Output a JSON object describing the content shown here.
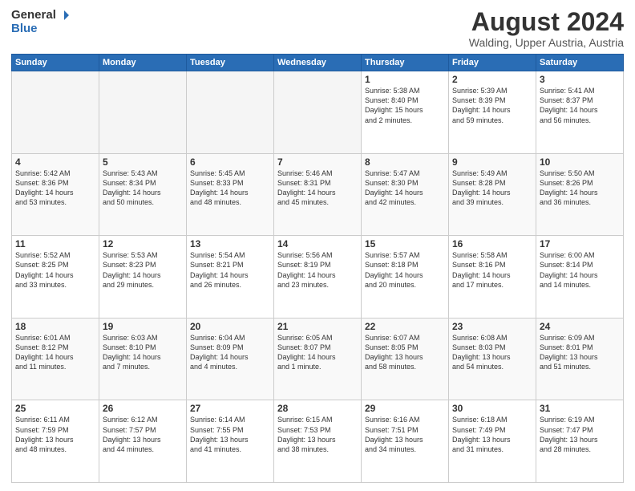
{
  "logo": {
    "general": "General",
    "blue": "Blue"
  },
  "title": "August 2024",
  "subtitle": "Walding, Upper Austria, Austria",
  "days_header": [
    "Sunday",
    "Monday",
    "Tuesday",
    "Wednesday",
    "Thursday",
    "Friday",
    "Saturday"
  ],
  "weeks": [
    [
      {
        "day": "",
        "info": "",
        "empty": true
      },
      {
        "day": "",
        "info": "",
        "empty": true
      },
      {
        "day": "",
        "info": "",
        "empty": true
      },
      {
        "day": "",
        "info": "",
        "empty": true
      },
      {
        "day": "1",
        "info": "Sunrise: 5:38 AM\nSunset: 8:40 PM\nDaylight: 15 hours\nand 2 minutes."
      },
      {
        "day": "2",
        "info": "Sunrise: 5:39 AM\nSunset: 8:39 PM\nDaylight: 14 hours\nand 59 minutes."
      },
      {
        "day": "3",
        "info": "Sunrise: 5:41 AM\nSunset: 8:37 PM\nDaylight: 14 hours\nand 56 minutes."
      }
    ],
    [
      {
        "day": "4",
        "info": "Sunrise: 5:42 AM\nSunset: 8:36 PM\nDaylight: 14 hours\nand 53 minutes."
      },
      {
        "day": "5",
        "info": "Sunrise: 5:43 AM\nSunset: 8:34 PM\nDaylight: 14 hours\nand 50 minutes."
      },
      {
        "day": "6",
        "info": "Sunrise: 5:45 AM\nSunset: 8:33 PM\nDaylight: 14 hours\nand 48 minutes."
      },
      {
        "day": "7",
        "info": "Sunrise: 5:46 AM\nSunset: 8:31 PM\nDaylight: 14 hours\nand 45 minutes."
      },
      {
        "day": "8",
        "info": "Sunrise: 5:47 AM\nSunset: 8:30 PM\nDaylight: 14 hours\nand 42 minutes."
      },
      {
        "day": "9",
        "info": "Sunrise: 5:49 AM\nSunset: 8:28 PM\nDaylight: 14 hours\nand 39 minutes."
      },
      {
        "day": "10",
        "info": "Sunrise: 5:50 AM\nSunset: 8:26 PM\nDaylight: 14 hours\nand 36 minutes."
      }
    ],
    [
      {
        "day": "11",
        "info": "Sunrise: 5:52 AM\nSunset: 8:25 PM\nDaylight: 14 hours\nand 33 minutes."
      },
      {
        "day": "12",
        "info": "Sunrise: 5:53 AM\nSunset: 8:23 PM\nDaylight: 14 hours\nand 29 minutes."
      },
      {
        "day": "13",
        "info": "Sunrise: 5:54 AM\nSunset: 8:21 PM\nDaylight: 14 hours\nand 26 minutes."
      },
      {
        "day": "14",
        "info": "Sunrise: 5:56 AM\nSunset: 8:19 PM\nDaylight: 14 hours\nand 23 minutes."
      },
      {
        "day": "15",
        "info": "Sunrise: 5:57 AM\nSunset: 8:18 PM\nDaylight: 14 hours\nand 20 minutes."
      },
      {
        "day": "16",
        "info": "Sunrise: 5:58 AM\nSunset: 8:16 PM\nDaylight: 14 hours\nand 17 minutes."
      },
      {
        "day": "17",
        "info": "Sunrise: 6:00 AM\nSunset: 8:14 PM\nDaylight: 14 hours\nand 14 minutes."
      }
    ],
    [
      {
        "day": "18",
        "info": "Sunrise: 6:01 AM\nSunset: 8:12 PM\nDaylight: 14 hours\nand 11 minutes."
      },
      {
        "day": "19",
        "info": "Sunrise: 6:03 AM\nSunset: 8:10 PM\nDaylight: 14 hours\nand 7 minutes."
      },
      {
        "day": "20",
        "info": "Sunrise: 6:04 AM\nSunset: 8:09 PM\nDaylight: 14 hours\nand 4 minutes."
      },
      {
        "day": "21",
        "info": "Sunrise: 6:05 AM\nSunset: 8:07 PM\nDaylight: 14 hours\nand 1 minute."
      },
      {
        "day": "22",
        "info": "Sunrise: 6:07 AM\nSunset: 8:05 PM\nDaylight: 13 hours\nand 58 minutes."
      },
      {
        "day": "23",
        "info": "Sunrise: 6:08 AM\nSunset: 8:03 PM\nDaylight: 13 hours\nand 54 minutes."
      },
      {
        "day": "24",
        "info": "Sunrise: 6:09 AM\nSunset: 8:01 PM\nDaylight: 13 hours\nand 51 minutes."
      }
    ],
    [
      {
        "day": "25",
        "info": "Sunrise: 6:11 AM\nSunset: 7:59 PM\nDaylight: 13 hours\nand 48 minutes."
      },
      {
        "day": "26",
        "info": "Sunrise: 6:12 AM\nSunset: 7:57 PM\nDaylight: 13 hours\nand 44 minutes."
      },
      {
        "day": "27",
        "info": "Sunrise: 6:14 AM\nSunset: 7:55 PM\nDaylight: 13 hours\nand 41 minutes."
      },
      {
        "day": "28",
        "info": "Sunrise: 6:15 AM\nSunset: 7:53 PM\nDaylight: 13 hours\nand 38 minutes."
      },
      {
        "day": "29",
        "info": "Sunrise: 6:16 AM\nSunset: 7:51 PM\nDaylight: 13 hours\nand 34 minutes."
      },
      {
        "day": "30",
        "info": "Sunrise: 6:18 AM\nSunset: 7:49 PM\nDaylight: 13 hours\nand 31 minutes."
      },
      {
        "day": "31",
        "info": "Sunrise: 6:19 AM\nSunset: 7:47 PM\nDaylight: 13 hours\nand 28 minutes."
      }
    ]
  ]
}
